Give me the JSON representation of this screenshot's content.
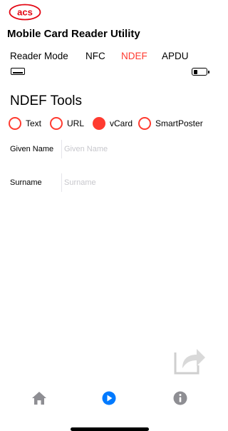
{
  "app": {
    "logo_text": "acs",
    "title": "Mobile Card Reader Utility"
  },
  "tabs": [
    {
      "label": "Reader Mode",
      "active": false
    },
    {
      "label": "NFC",
      "active": false
    },
    {
      "label": "NDEF",
      "active": true
    },
    {
      "label": "APDU",
      "active": false
    }
  ],
  "status": {
    "reader_icon": "card-reader-icon",
    "battery_icon": "battery-icon",
    "battery_level": 0.4
  },
  "ndef": {
    "section_title": "NDEF Tools",
    "record_types": [
      {
        "label": "Text",
        "selected": false
      },
      {
        "label": "URL",
        "selected": false
      },
      {
        "label": "vCard",
        "selected": true
      },
      {
        "label": "SmartPoster",
        "selected": false
      }
    ],
    "fields": {
      "given_name": {
        "label": "Given Name",
        "placeholder": "Given Name",
        "value": ""
      },
      "surname": {
        "label": "Surname",
        "placeholder": "Surname",
        "value": ""
      }
    }
  },
  "actions": {
    "share_icon": "share-arrow-icon"
  },
  "tab_bar": {
    "home_icon": "home-icon",
    "play_icon": "play-icon",
    "info_icon": "info-icon"
  },
  "colors": {
    "accent": "#ff3b30",
    "selected_tab": "#007aff",
    "inactive_icon": "#8e8e93",
    "placeholder": "#c7c7cc"
  }
}
